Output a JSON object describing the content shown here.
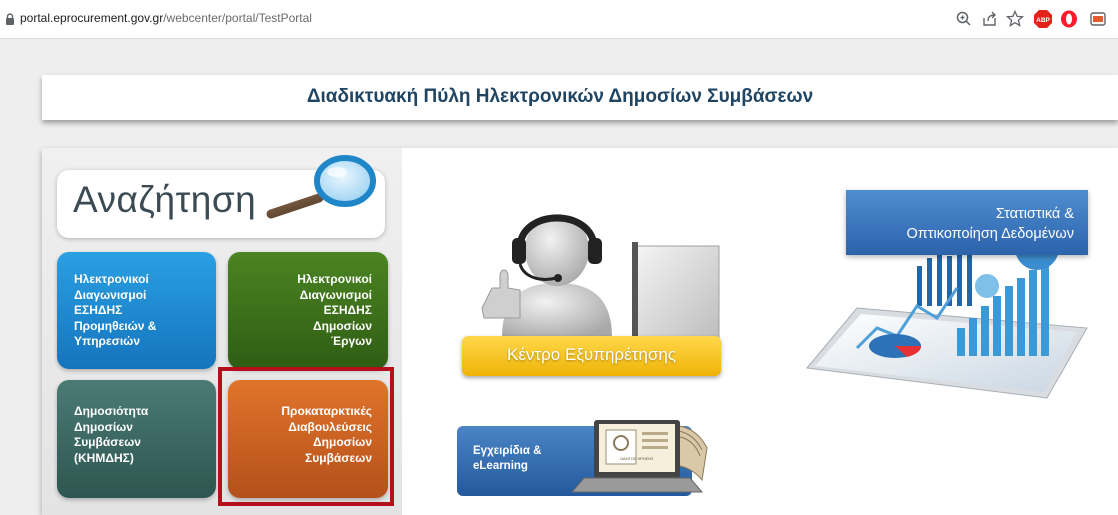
{
  "browser": {
    "url_host": "portal.eprocurement.gov.gr",
    "url_path": "/webcenter/portal/TestPortal",
    "toolbar_icons": [
      "zoom-icon",
      "share-icon",
      "bookmark-star-icon",
      "adblock-icon",
      "opera-icon",
      "extension-icon"
    ],
    "adblock_label": "ABP"
  },
  "header": {
    "title": "Διαδικτυακή Πύλη Ηλεκτρονικών Δημοσίων Συμβάσεων"
  },
  "search": {
    "label": "Αναζήτηση"
  },
  "tiles": [
    {
      "lines": [
        "Ηλεκτρονικοί",
        "Διαγωνισμοί",
        "ΕΣΗΔΗΣ",
        "Προμηθειών &",
        "Υπηρεσιών"
      ],
      "color": "#1f8fd6"
    },
    {
      "lines": [
        "Ηλεκτρονικοί",
        "Διαγωνισμοί",
        "ΕΣΗΔΗΣ",
        "Δημοσίων",
        "Έργων"
      ],
      "color": "#3e7a1c"
    },
    {
      "lines": [
        "Δημοσιότητα",
        "Δημοσίων",
        "Συμβάσεων",
        "(ΚΗΜΔΗΣ)"
      ],
      "color": "#3f6c66"
    },
    {
      "lines": [
        "Προκαταρκτικές",
        "Διαβουλεύσεις",
        "Δημοσίων",
        "Συμβάσεων"
      ],
      "color": "#d4672a",
      "highlighted": true
    }
  ],
  "support": {
    "label": "Κέντρο Εξυπηρέτησης"
  },
  "manuals": {
    "lines": [
      "Εγχειρίδια &",
      "eLearning"
    ],
    "screen_text": "ΟΔΗΓΟΣ ΧΡΗΣΗΣ"
  },
  "stats": {
    "lines": [
      "Στατιστικά &",
      "Οπτικοποίηση Δεδομένων"
    ]
  },
  "colors": {
    "highlight_border": "#b40f1a",
    "header_text": "#1f4563",
    "support_button": "#f5c518"
  }
}
